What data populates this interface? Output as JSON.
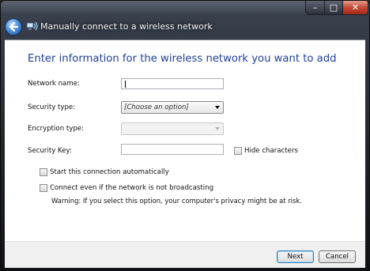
{
  "window": {
    "title": "Manually connect to a wireless network",
    "controls": {
      "minimize": "–",
      "maximize": "□",
      "close": "✕"
    }
  },
  "heading": "Enter information for the wireless network you want to add",
  "form": {
    "network_name": {
      "label": "Network name:",
      "value": ""
    },
    "security_type": {
      "label": "Security type:",
      "value": "[Choose an option]"
    },
    "encryption_type": {
      "label": "Encryption type:",
      "value": ""
    },
    "security_key": {
      "label": "Security Key:",
      "value": ""
    },
    "hide_characters": {
      "label": "Hide characters",
      "checked": false
    }
  },
  "options": {
    "start_automatically": {
      "label": "Start this connection automatically",
      "checked": false
    },
    "connect_even_if_not_broadcasting": {
      "label": "Connect even if the network is not broadcasting",
      "checked": false
    },
    "warning": "Warning: If you select this option, your computer's privacy might be at risk."
  },
  "buttons": {
    "next": "Next",
    "cancel": "Cancel"
  },
  "colors": {
    "heading": "#1f3e99",
    "background": "#ffffff",
    "footer": "#f0f0f0"
  }
}
